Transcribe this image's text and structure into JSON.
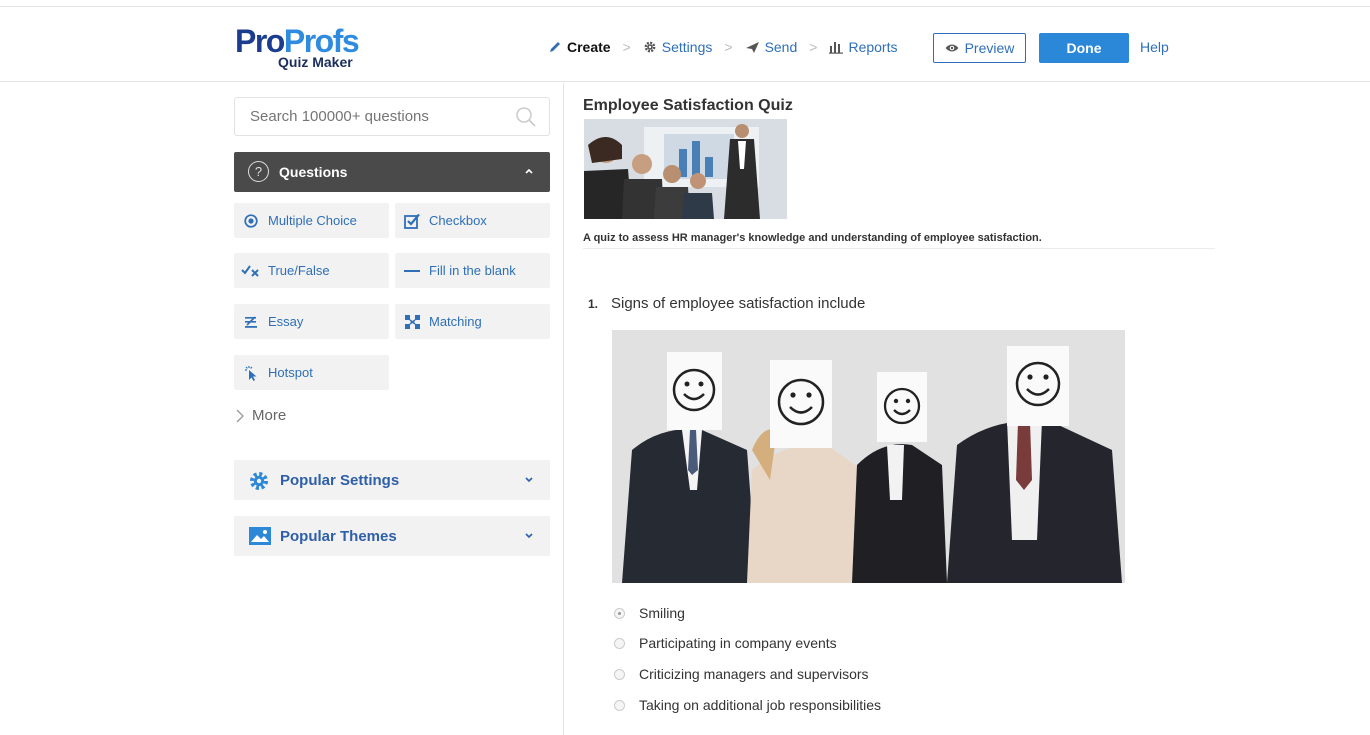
{
  "header": {
    "logo_top": "ProProfs",
    "logo_pro": "Pro",
    "logo_profs": "Profs",
    "logo_sub": "Quiz Maker",
    "steps": [
      {
        "label": "Create",
        "icon": "pencil-icon"
      },
      {
        "label": "Settings",
        "icon": "gear-icon"
      },
      {
        "label": "Send",
        "icon": "send-icon"
      },
      {
        "label": "Reports",
        "icon": "bar-chart-icon"
      }
    ],
    "separator": ">",
    "preview_label": "Preview",
    "done_label": "Done",
    "help_label": "Help",
    "accent_color": "#2b88d8"
  },
  "sidebar": {
    "search_placeholder": "Search 100000+ questions",
    "questions_label": "Questions",
    "question_types": [
      {
        "label": "Multiple Choice",
        "icon": "radio-icon"
      },
      {
        "label": "Checkbox",
        "icon": "checkbox-icon"
      },
      {
        "label": "True/False",
        "icon": "true-false-icon"
      },
      {
        "label": "Fill in the blank",
        "icon": "dash-icon"
      },
      {
        "label": "Essay",
        "icon": "essay-icon"
      },
      {
        "label": "Matching",
        "icon": "matching-icon"
      },
      {
        "label": "Hotspot",
        "icon": "hotspot-icon"
      }
    ],
    "more_label": "More",
    "popular_settings_label": "Popular Settings",
    "popular_themes_label": "Popular Themes"
  },
  "quiz": {
    "title": "Employee Satisfaction Quiz",
    "description": "A quiz to assess HR manager's knowledge and understanding of employee satisfaction.",
    "question": {
      "number": "1.",
      "text": "Signs of employee satisfaction include",
      "options": [
        {
          "label": "Smiling",
          "selected": true
        },
        {
          "label": "Participating in company events",
          "selected": false
        },
        {
          "label": "Criticizing managers and supervisors",
          "selected": false
        },
        {
          "label": "Taking on additional job responsibilities",
          "selected": false
        }
      ]
    }
  }
}
